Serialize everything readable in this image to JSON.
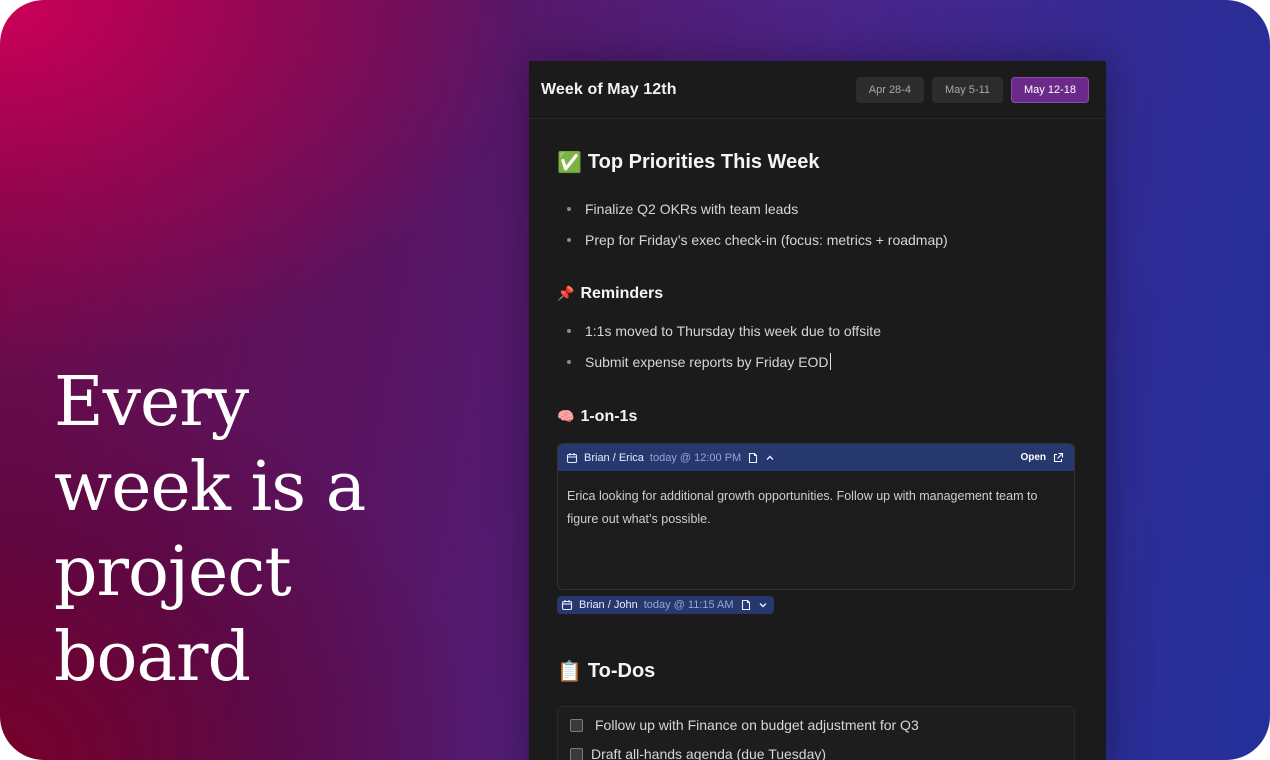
{
  "headline": [
    "Every",
    "week is a",
    "project",
    "board"
  ],
  "topbar": {
    "title": "Week of May 12th",
    "tabs": [
      {
        "label": "Apr 28-4",
        "active": false
      },
      {
        "label": "May 5-11",
        "active": false
      },
      {
        "label": "May 12-18",
        "active": true
      }
    ]
  },
  "priorities": {
    "emoji": "✅",
    "heading": "Top Priorities This Week",
    "items": [
      "Finalize Q2 OKRs with team leads",
      "Prep for Friday’s exec check-in (focus: metrics + roadmap)"
    ]
  },
  "reminders": {
    "emoji": "📌",
    "heading": "Reminders",
    "items": [
      "1:1s moved to Thursday this week due to offsite",
      "Submit expense reports by Friday EOD"
    ]
  },
  "one_on_ones": {
    "emoji": "🧠",
    "heading": "1-on-1s",
    "meetings": [
      {
        "who": "Brian / Erica",
        "when": "today @ 12:00 PM",
        "open_label": "Open",
        "notes": "Erica looking for additional growth opportunities. Follow up with management team to figure out what’s possible.",
        "expanded": true
      },
      {
        "who": "Brian / John",
        "when": "today @ 11:15 AM",
        "expanded": false
      }
    ]
  },
  "todos": {
    "emoji": "📋",
    "heading": "To-Dos",
    "items": [
      "Follow up with Finance on budget adjustment for Q3",
      "Draft all-hands agenda (due Tuesday)"
    ]
  },
  "colors": {
    "accent_tab": "#6b2a8a",
    "meeting_header": "#27386e",
    "panel_bg": "#1b1b1b"
  },
  "icons": [
    "calendar-icon",
    "note-icon",
    "chevron-up-icon",
    "chevron-down-icon",
    "external-link-icon",
    "checkbox-icon"
  ]
}
